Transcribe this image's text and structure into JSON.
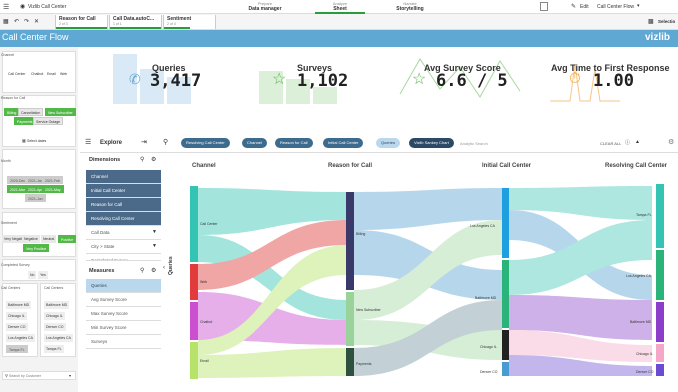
{
  "topbar": {
    "app_title": "Vizlib Call Center",
    "tabs": [
      {
        "sub": "Prepare",
        "main": "Data manager"
      },
      {
        "sub": "Analyze",
        "main": "Sheet"
      },
      {
        "sub": "Narrate",
        "main": "Storytelling"
      }
    ],
    "edit_label": "Edit",
    "sheet_name": "Call Center Flow"
  },
  "selections": [
    {
      "title": "Reason for Call",
      "sub": "2 of 3"
    },
    {
      "title": "Call Data.autoC...",
      "sub": "1 of 1"
    },
    {
      "title": "Sentiment",
      "sub": "2 of 4"
    }
  ],
  "selections_right": "Selectio",
  "banner": {
    "title": "Call Center Flow",
    "logo": "vizlib"
  },
  "left_panel": {
    "sections": [
      {
        "title": "Channel",
        "chips": [
          "Call Center",
          "Chatbot",
          "Email",
          "Web"
        ]
      },
      {
        "title": "Reason for Call",
        "chips": [
          "Billing",
          "Cancellation",
          "New Subscriber",
          "Payments",
          "Service Outage"
        ]
      },
      {
        "title": "Month",
        "chips": [
          "2020-Dec",
          "2021-Jan",
          "2021-Feb",
          "2021-Mar",
          "2021-Apr",
          "2021-May",
          "2021-Jun"
        ]
      },
      {
        "title": "Sentiment",
        "chips": [
          "Very Negative",
          "Negative",
          "Neutral",
          "Positive",
          "Very Positive"
        ]
      },
      {
        "title": "Completed Survey",
        "chips": [
          "No",
          "Yes"
        ]
      },
      {
        "title": "Call Centers",
        "chips": [
          "Baltimore MD",
          "Chicago IL",
          "Denver CO",
          "Los Angeles CA",
          "Tampa FL"
        ]
      },
      {
        "title": "Call Centers",
        "chips": [
          "Baltimore MD",
          "Chicago IL",
          "Denver CO",
          "Los Angeles CA",
          "Tampa FL"
        ]
      }
    ],
    "select_dates": "Select dates",
    "search_customer": "Search by Customer"
  },
  "kpis": [
    {
      "label": "Queries",
      "value": "3,417"
    },
    {
      "label": "Surveys",
      "value": "1,102"
    },
    {
      "label": "Avg Survey Score",
      "value": "6.6 / 5"
    },
    {
      "label": "Avg Time to First Response",
      "value": "1.00"
    }
  ],
  "explore": {
    "title": "Explore",
    "pills": [
      "Resolving Call Center",
      "Channel",
      "Reason for Call",
      "Initial Call Center",
      "Queries",
      "Vizlib Sankey Chart"
    ],
    "search_placeholder": "Analytic Search",
    "clear_all": "CLEAR ALL"
  },
  "dimensions": {
    "title": "Dimensions",
    "items": [
      "Channel",
      "Initial Call Center",
      "Reason for Call",
      "Resolving Call Center",
      "Call Data",
      "City > State",
      "Completed Survey"
    ]
  },
  "measures": {
    "title": "Measures",
    "items": [
      "Queries",
      "Avg Survey Score",
      "Max Survey Score",
      "Min Survey Score",
      "Surveys"
    ]
  },
  "sankey": {
    "y_label": "Queries",
    "columns": [
      "Channel",
      "Reason for Call",
      "Initial Call Center",
      "Resolving Call Center"
    ],
    "nodes": {
      "channel": [
        "Call Center",
        "Web",
        "Chatbot",
        "Email"
      ],
      "reason": [
        "Billing",
        "New Subscriber",
        "Payments"
      ],
      "initial": [
        "Los Angeles CA",
        "Baltimore MD",
        "Chicago IL",
        "Denver CO"
      ],
      "resolving": [
        "Tampa FL",
        "Los Angeles CA",
        "Baltimore MD",
        "Chicago IL",
        "Denver CO"
      ]
    }
  }
}
